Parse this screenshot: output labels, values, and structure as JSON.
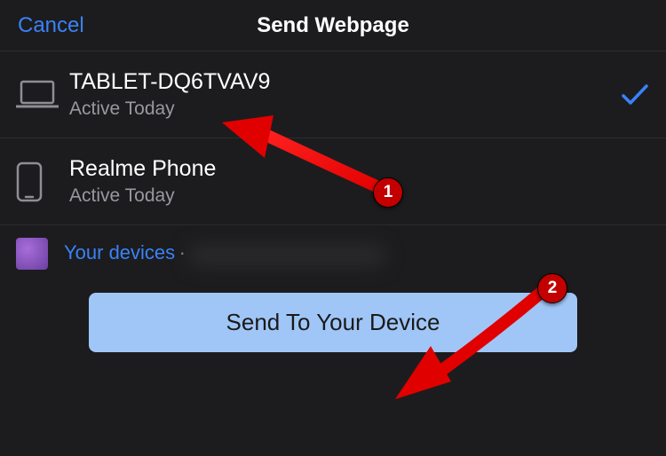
{
  "header": {
    "cancel": "Cancel",
    "title": "Send Webpage"
  },
  "devices": [
    {
      "name": "TABLET-DQ6TVAV9",
      "status": "Active Today",
      "icon": "laptop",
      "selected": true
    },
    {
      "name": "Realme Phone",
      "status": "Active Today",
      "icon": "phone",
      "selected": false
    }
  ],
  "info": {
    "label": "Your devices",
    "separator": "·"
  },
  "action": {
    "primary": "Send To Your Device"
  },
  "annotations": {
    "badge1": "1",
    "badge2": "2"
  }
}
